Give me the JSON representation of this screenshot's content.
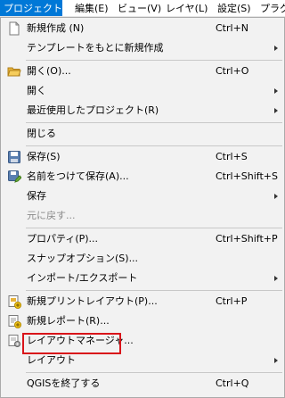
{
  "menubar": {
    "items": [
      {
        "label": "プロジェクト(J)",
        "active": true
      },
      {
        "label": "編集(E)"
      },
      {
        "label": "ビュー(V)"
      },
      {
        "label": "レイヤ(L)"
      },
      {
        "label": "設定(S)"
      },
      {
        "label": "プラグ"
      }
    ]
  },
  "menu": {
    "new_project": {
      "label": "新規作成 (N)",
      "shortcut": "Ctrl+N"
    },
    "new_from_template": {
      "label": "テンプレートをもとに新規作成"
    },
    "open": {
      "label": "開く(O)...",
      "shortcut": "Ctrl+O"
    },
    "open_from": {
      "label": "開く"
    },
    "recent_projects": {
      "label": "最近使用したプロジェクト(R)"
    },
    "close": {
      "label": "閉じる"
    },
    "save": {
      "label": "保存(S)",
      "shortcut": "Ctrl+S"
    },
    "save_as": {
      "label": "名前をつけて保存(A)...",
      "shortcut": "Ctrl+Shift+S"
    },
    "save_to": {
      "label": "保存"
    },
    "revert": {
      "label": "元に戻す..."
    },
    "properties": {
      "label": "プロパティ(P)...",
      "shortcut": "Ctrl+Shift+P"
    },
    "snapping_options": {
      "label": "スナップオプション(S)..."
    },
    "import_export": {
      "label": "インポート/エクスポート"
    },
    "new_print_layout": {
      "label": "新規プリントレイアウト(P)...",
      "shortcut": "Ctrl+P"
    },
    "new_report": {
      "label": "新規レポート(R)..."
    },
    "layout_manager": {
      "label": "レイアウトマネージャ..."
    },
    "layouts": {
      "label": "レイアウト"
    },
    "exit": {
      "label": "QGISを終了する",
      "shortcut": "Ctrl+Q"
    }
  },
  "colors": {
    "accent": "#0078d7",
    "highlight_outline": "#d9141a"
  }
}
